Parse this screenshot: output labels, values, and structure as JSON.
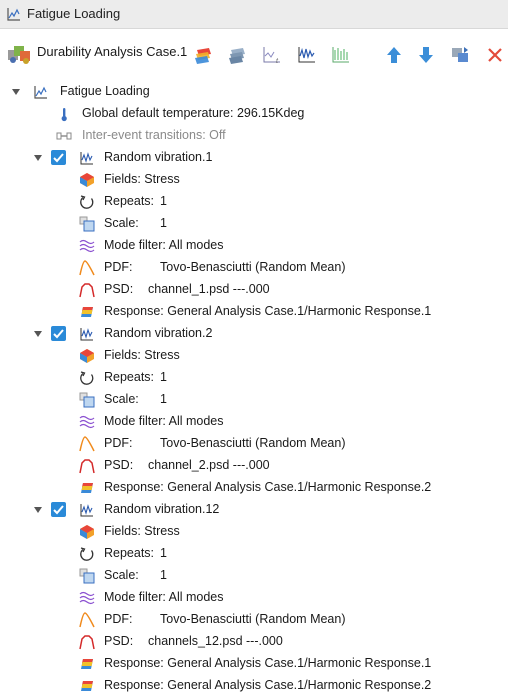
{
  "window": {
    "title": "Fatigue Loading"
  },
  "toolbar": {
    "case_label": "Durability Analysis Case.1"
  },
  "tree": {
    "root_label": "Fatigue Loading",
    "global_temp": "Global default temperature: 296.15Kdeg",
    "inter_event": "Inter-event transitions: Off",
    "events": [
      {
        "label": "Random vibration.1",
        "fields": "Fields: Stress",
        "repeats_label": "Repeats:",
        "repeats": "1",
        "scale_label": "Scale:",
        "scale": "1",
        "mode_filter": "Mode filter: All modes",
        "pdf_label": "PDF:",
        "pdf": "Tovo-Benasciutti (Random Mean)",
        "psd_label": "PSD:",
        "psd": "channel_1.psd ---.000",
        "responses": [
          "Response: General Analysis Case.1/Harmonic Response.1"
        ]
      },
      {
        "label": "Random vibration.2",
        "fields": "Fields: Stress",
        "repeats_label": "Repeats:",
        "repeats": "1",
        "scale_label": "Scale:",
        "scale": "1",
        "mode_filter": "Mode filter: All modes",
        "pdf_label": "PDF:",
        "pdf": "Tovo-Benasciutti (Random Mean)",
        "psd_label": "PSD:",
        "psd": "channel_2.psd ---.000",
        "responses": [
          "Response: General Analysis Case.1/Harmonic Response.2"
        ]
      },
      {
        "label": "Random vibration.12",
        "fields": "Fields: Stress",
        "repeats_label": "Repeats:",
        "repeats": "1",
        "scale_label": "Scale:",
        "scale": "1",
        "mode_filter": "Mode filter: All modes",
        "pdf_label": "PDF:",
        "pdf": "Tovo-Benasciutti (Random Mean)",
        "psd_label": "PSD:",
        "psd": "channels_12.psd ---.000",
        "responses": [
          "Response: General Analysis Case.1/Harmonic Response.1",
          "Response: General Analysis Case.1/Harmonic Response.2"
        ]
      }
    ]
  },
  "colors": {
    "checkbox": "#2a8ad8",
    "blue_arrow": "#3b8ed8",
    "delete": "#e34a3a",
    "pdf_curve": "#f08a1c",
    "psd_curve": "#d42a2a",
    "mode_filter": "#8a4fd0"
  }
}
